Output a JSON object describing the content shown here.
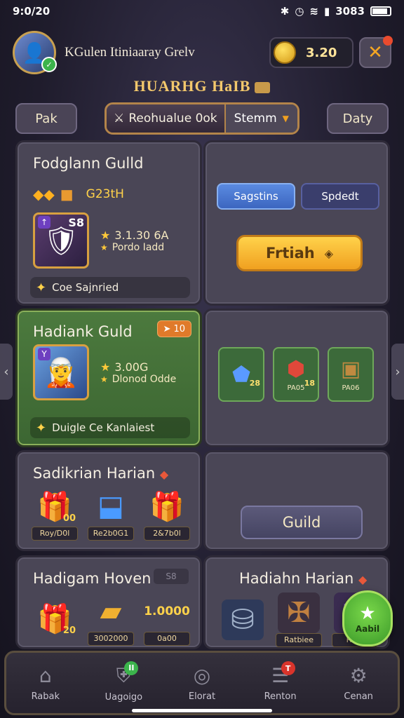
{
  "status_bar": {
    "time": "9:0/20",
    "battery_text": "3083"
  },
  "header": {
    "player_name": "KGulen Itiniaaray Grelv",
    "currency_value": "3.20",
    "close_icon": "close-x-icon"
  },
  "screen_title": "HUARHG HaIB",
  "tabs": {
    "left": "Pak",
    "selected": "Reohualue 0ok",
    "dropdown": "Stemm",
    "right": "Daty"
  },
  "panels": {
    "guild1": {
      "title": "Fodglann Gulld",
      "rank": "G23tH",
      "level": "S8",
      "stat1": "3.1.30 6A",
      "stat2": "Pordo Iadd",
      "status": "Coe Sajnried",
      "btn_a": "Sagstins",
      "btn_b": "Spdedt",
      "action": "Frtiah"
    },
    "guild2": {
      "title": "Hadiank Guld",
      "badge": "10",
      "stat1": "3.00G",
      "stat2": "Dlonod Odde",
      "status": "Duigle Ce Kanlaiest"
    },
    "items": [
      {
        "label": "",
        "count": "28"
      },
      {
        "label": "PA05",
        "count": "18"
      },
      {
        "label": "PA06",
        "count": ""
      }
    ],
    "rewards1": {
      "title": "Sadikrian Harian",
      "items": [
        {
          "label": "Roy/D0l",
          "count": "00"
        },
        {
          "label": "Re2b0G1",
          "count": ""
        },
        {
          "label": "2&7b0l",
          "count": ""
        }
      ]
    },
    "guild_button": "Guild",
    "rewards2": {
      "title": "Hadigam Hoven",
      "tag": "S8",
      "items": [
        {
          "label": "",
          "count": "20"
        },
        {
          "label": "3002000",
          "count": ""
        },
        {
          "label": "0a00",
          "value": "1.0000"
        }
      ]
    },
    "rewards3": {
      "title": "Hadiahn Harian",
      "items": [
        {
          "label": ""
        },
        {
          "label": "Ratbiee"
        },
        {
          "label": "Ridd"
        }
      ]
    }
  },
  "fab": {
    "label": "Aabil"
  },
  "nav": [
    {
      "label": "Rabak",
      "icon": "home-icon"
    },
    {
      "label": "Uagoigo",
      "icon": "shield-icon",
      "badge": "II"
    },
    {
      "label": "Elorat",
      "icon": "target-icon"
    },
    {
      "label": "Renton",
      "icon": "list-icon",
      "badge": "T"
    },
    {
      "label": "Cenan",
      "icon": "gear-icon"
    }
  ],
  "colors": {
    "accent": "#f0a020",
    "green_panel": "#4c7a3e",
    "badge_red": "#d9342b",
    "badge_green": "#3cb44c"
  }
}
